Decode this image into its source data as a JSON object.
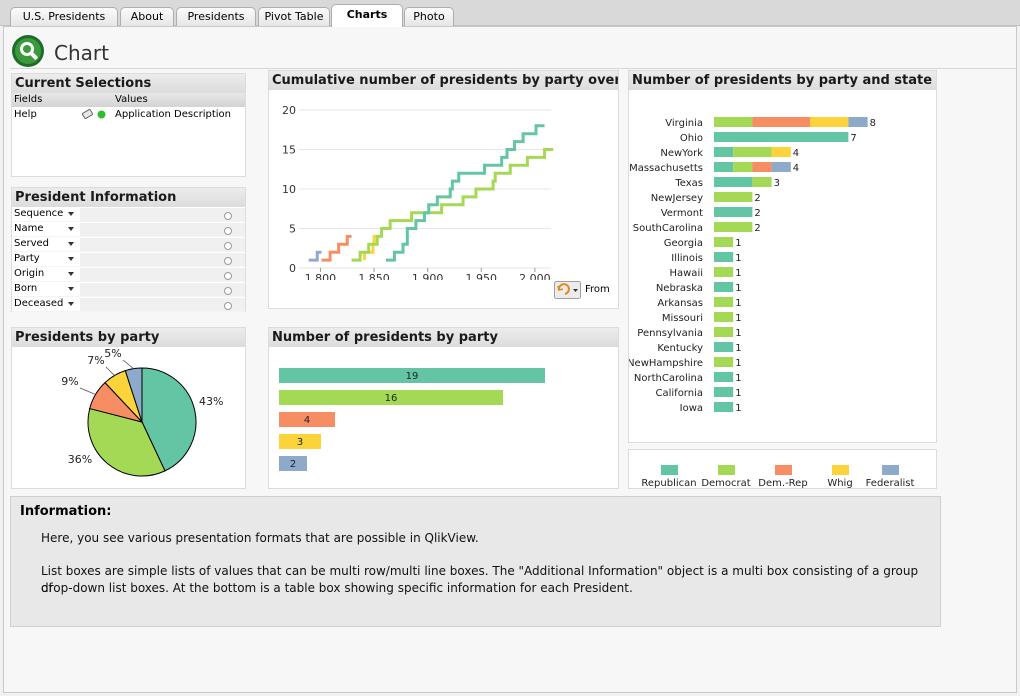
{
  "tabs": [
    {
      "label": "U.S. Presidents"
    },
    {
      "label": "About"
    },
    {
      "label": "Presidents"
    },
    {
      "label": "Pivot Table"
    },
    {
      "label": "Charts"
    },
    {
      "label": "Photo"
    }
  ],
  "active_tab": "Charts",
  "page_title": "Chart",
  "current_selections": {
    "title": "Current Selections",
    "col_fields": "Fields",
    "col_values": "Values",
    "rows": [
      {
        "field": "Help",
        "value": "Application Description"
      }
    ]
  },
  "president_info": {
    "title": "President Information",
    "fields": [
      "Sequence",
      "Name",
      "Served",
      "Party",
      "Origin",
      "Born",
      "Deceased"
    ]
  },
  "colors": {
    "Republican": "#64c5a4",
    "Democrat": "#a4d956",
    "Dem.-Rep": "#f78d62",
    "Whig": "#fad43a",
    "Federalist": "#8eaacb"
  },
  "pie": {
    "title": "Presidents by party",
    "labels": [
      "43%",
      "36%",
      "9%",
      "7%",
      "5%"
    ]
  },
  "cumulative": {
    "title": "Cumulative number of presidents by party over time",
    "button_label": "From"
  },
  "bars": {
    "title": "Number of presidents by party"
  },
  "state_chart": {
    "title": "Number of presidents by party and state"
  },
  "legend_items": [
    "Republican",
    "Democrat",
    "Dem.-Rep",
    "Whig",
    "Federalist"
  ],
  "info": {
    "title": "Information:",
    "p1": "Here, you see various presentation formats that are possible in QlikView.",
    "p2a": "List boxes are simple lists of values that can be multi row/multi line boxes.  The \"Additional Information\" object is a multi box consisting of a group of",
    "p2b": "drop-down list boxes.  At the bottom is a table box showing specific information for each President."
  },
  "chart_data": [
    {
      "type": "pie",
      "title": "Presidents by party",
      "categories": [
        "Republican",
        "Democrat",
        "Dem.-Rep",
        "Whig",
        "Federalist"
      ],
      "values": [
        43,
        36,
        9,
        7,
        5
      ],
      "unit": "%"
    },
    {
      "type": "bar",
      "title": "Number of presidents by party",
      "categories": [
        "Republican",
        "Democrat",
        "Dem.-Rep",
        "Whig",
        "Federalist"
      ],
      "values": [
        19,
        16,
        4,
        3,
        2
      ],
      "xlim": [
        0,
        19
      ]
    },
    {
      "type": "line",
      "title": "Cumulative number of presidents by party over time",
      "xlim": [
        1780,
        2015
      ],
      "ylim": [
        0,
        20
      ],
      "xticks": [
        1800,
        1850,
        1900,
        1950,
        2000
      ],
      "xtick_labels": [
        "1 800",
        "1 850",
        "1 900",
        "1 950",
        "2 000"
      ],
      "yticks": [
        0,
        5,
        10,
        15,
        20
      ],
      "series": [
        {
          "name": "Federalist",
          "points": [
            [
              1789,
              1
            ],
            [
              1797,
              2
            ],
            [
              1801,
              2
            ]
          ]
        },
        {
          "name": "Dem.-Rep",
          "points": [
            [
              1801,
              1
            ],
            [
              1809,
              2
            ],
            [
              1817,
              3
            ],
            [
              1825,
              4
            ],
            [
              1829,
              4
            ]
          ]
        },
        {
          "name": "Whig",
          "points": [
            [
              1841,
              1
            ],
            [
              1841,
              2
            ],
            [
              1849,
              3
            ],
            [
              1850,
              4
            ],
            [
              1853,
              4
            ]
          ]
        },
        {
          "name": "Democrat",
          "points": [
            [
              1829,
              1
            ],
            [
              1837,
              2
            ],
            [
              1845,
              3
            ],
            [
              1853,
              4
            ],
            [
              1857,
              5
            ],
            [
              1865,
              6
            ],
            [
              1869,
              6
            ],
            [
              1885,
              7
            ],
            [
              1889,
              7
            ],
            [
              1893,
              7
            ],
            [
              1913,
              8
            ],
            [
              1921,
              8
            ],
            [
              1933,
              9
            ],
            [
              1945,
              10
            ],
            [
              1953,
              10
            ],
            [
              1961,
              11
            ],
            [
              1963,
              12
            ],
            [
              1969,
              12
            ],
            [
              1977,
              13
            ],
            [
              1981,
              13
            ],
            [
              1993,
              14
            ],
            [
              2001,
              14
            ],
            [
              2009,
              15
            ],
            [
              2017,
              15
            ]
          ]
        },
        {
          "name": "Republican",
          "points": [
            [
              1861,
              1
            ],
            [
              1869,
              2
            ],
            [
              1877,
              3
            ],
            [
              1881,
              4
            ],
            [
              1881,
              5
            ],
            [
              1885,
              5
            ],
            [
              1889,
              6
            ],
            [
              1893,
              6
            ],
            [
              1897,
              7
            ],
            [
              1901,
              8
            ],
            [
              1909,
              9
            ],
            [
              1913,
              9
            ],
            [
              1921,
              10
            ],
            [
              1923,
              11
            ],
            [
              1929,
              12
            ],
            [
              1933,
              12
            ],
            [
              1953,
              13
            ],
            [
              1961,
              13
            ],
            [
              1969,
              14
            ],
            [
              1974,
              15
            ],
            [
              1977,
              15
            ],
            [
              1981,
              16
            ],
            [
              1989,
              17
            ],
            [
              1993,
              17
            ],
            [
              2001,
              18
            ],
            [
              2009,
              18
            ]
          ]
        }
      ]
    },
    {
      "type": "bar",
      "stacked": true,
      "title": "Number of presidents by party and state",
      "series_names": [
        "Republican",
        "Democrat",
        "Dem.-Rep",
        "Whig",
        "Federalist"
      ],
      "rows": [
        {
          "state": "Virginia",
          "values": [
            0,
            2,
            3,
            2,
            1
          ],
          "total": 8
        },
        {
          "state": "Ohio",
          "values": [
            7,
            0,
            0,
            0,
            0
          ],
          "total": 7
        },
        {
          "state": "NewYork",
          "values": [
            1,
            2,
            0,
            1,
            0
          ],
          "total": 4
        },
        {
          "state": "Massachusetts",
          "values": [
            1,
            1,
            1,
            0,
            1
          ],
          "total": 4
        },
        {
          "state": "Texas",
          "values": [
            2,
            1,
            0,
            0,
            0
          ],
          "total": 3
        },
        {
          "state": "NewJersey",
          "values": [
            0,
            2,
            0,
            0,
            0
          ],
          "total": 2
        },
        {
          "state": "Vermont",
          "values": [
            2,
            0,
            0,
            0,
            0
          ],
          "total": 2
        },
        {
          "state": "SouthCarolina",
          "values": [
            0,
            2,
            0,
            0,
            0
          ],
          "total": 2
        },
        {
          "state": "Georgia",
          "values": [
            0,
            1,
            0,
            0,
            0
          ],
          "total": 1
        },
        {
          "state": "Illinois",
          "values": [
            1,
            0,
            0,
            0,
            0
          ],
          "total": 1
        },
        {
          "state": "Hawaii",
          "values": [
            0,
            1,
            0,
            0,
            0
          ],
          "total": 1
        },
        {
          "state": "Nebraska",
          "values": [
            1,
            0,
            0,
            0,
            0
          ],
          "total": 1
        },
        {
          "state": "Arkansas",
          "values": [
            0,
            1,
            0,
            0,
            0
          ],
          "total": 1
        },
        {
          "state": "Missouri",
          "values": [
            0,
            1,
            0,
            0,
            0
          ],
          "total": 1
        },
        {
          "state": "Pennsylvania",
          "values": [
            0,
            1,
            0,
            0,
            0
          ],
          "total": 1
        },
        {
          "state": "Kentucky",
          "values": [
            1,
            0,
            0,
            0,
            0
          ],
          "total": 1
        },
        {
          "state": "NewHampshire",
          "values": [
            0,
            1,
            0,
            0,
            0
          ],
          "total": 1
        },
        {
          "state": "NorthCarolina",
          "values": [
            1,
            0,
            0,
            0,
            0
          ],
          "total": 1
        },
        {
          "state": "California",
          "values": [
            1,
            0,
            0,
            0,
            0
          ],
          "total": 1
        },
        {
          "state": "Iowa",
          "values": [
            1,
            0,
            0,
            0,
            0
          ],
          "total": 1
        }
      ]
    }
  ]
}
